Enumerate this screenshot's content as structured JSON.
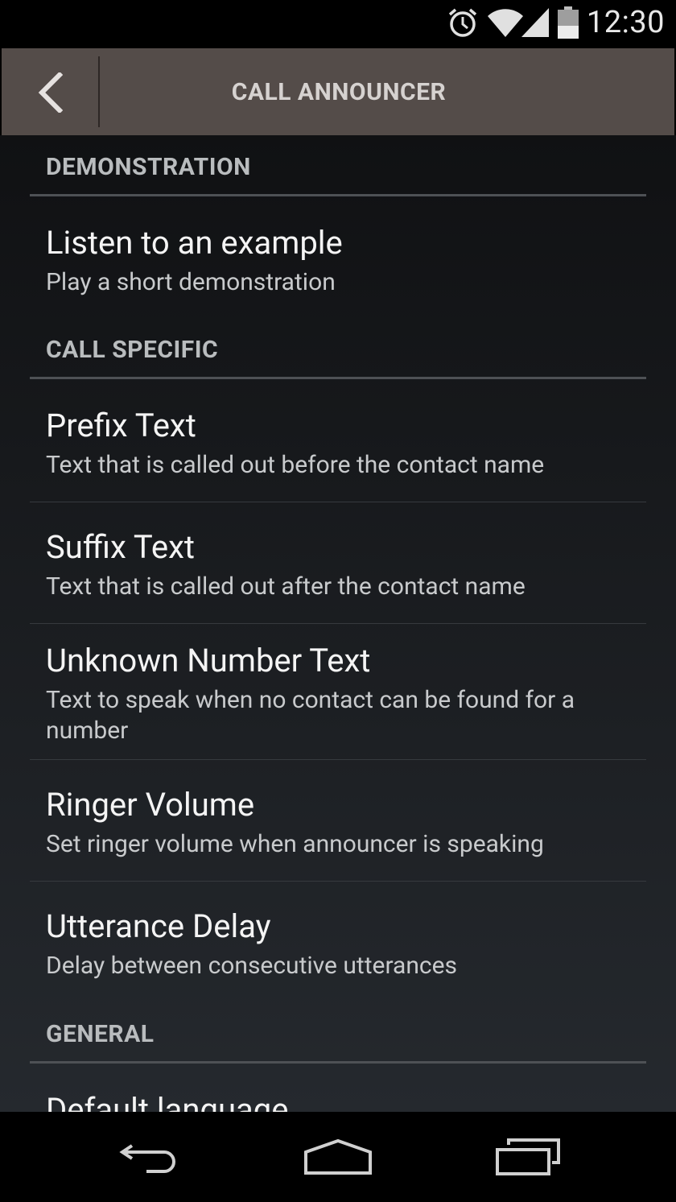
{
  "status_bar": {
    "time": "12:30",
    "icons": [
      "alarm-icon",
      "wifi-icon",
      "signal-icon",
      "battery-icon"
    ]
  },
  "action_bar": {
    "title": "CALL ANNOUNCER",
    "back_icon": "chevron-left-icon",
    "background": "#544c49"
  },
  "sections": {
    "demonstration": "DEMONSTRATION",
    "call_specific": "CALL SPECIFIC",
    "general": "GENERAL"
  },
  "prefs": {
    "listen": {
      "title": "Listen to an example",
      "summary": "Play a short demonstration"
    },
    "prefix": {
      "title": "Prefix Text",
      "summary": "Text that is called out before the contact name"
    },
    "suffix": {
      "title": "Suffix Text",
      "summary": "Text that is called out after the contact name"
    },
    "unknown": {
      "title": "Unknown Number Text",
      "summary": "Text to speak when no contact can be found for a number"
    },
    "ringer": {
      "title": "Ringer Volume",
      "summary": "Set ringer volume when announcer is speaking"
    },
    "delay": {
      "title": "Utterance Delay",
      "summary": "Delay between consecutive utterances"
    },
    "language": {
      "title": "Default language"
    }
  },
  "nav_bar": {
    "buttons": [
      "back-icon",
      "home-icon",
      "recent-apps-icon"
    ]
  }
}
